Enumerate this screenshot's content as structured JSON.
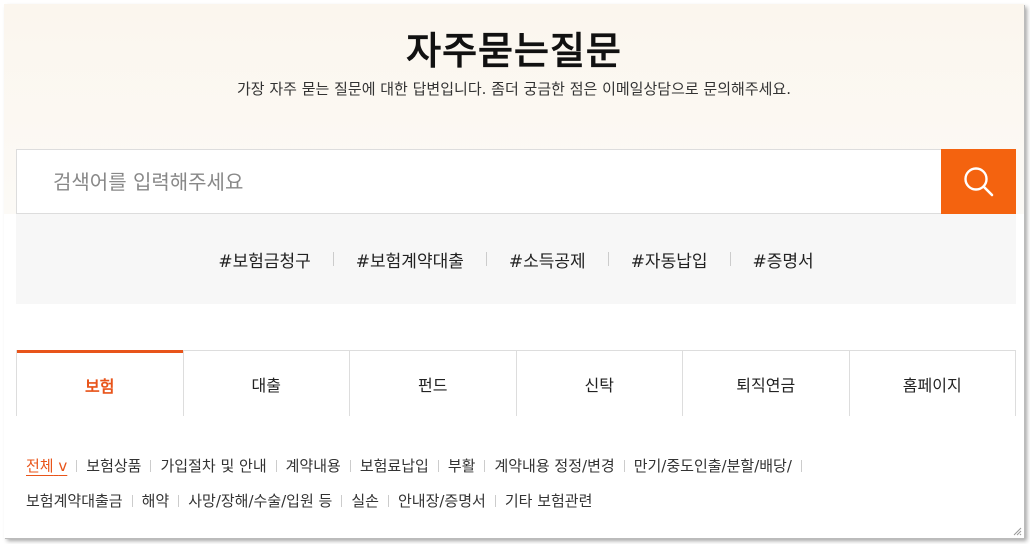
{
  "hero": {
    "title": "자주묻는질문",
    "subtitle": "가장 자주 묻는 질문에 대한 답변입니다. 좀더 궁금한 점은 이메일상담으로 문의해주세요."
  },
  "search": {
    "placeholder": "검색어를 입력해주세요",
    "value": ""
  },
  "hashtags": [
    "#보험금청구",
    "#보험계약대출",
    "#소득공제",
    "#자동납입",
    "#증명서"
  ],
  "tabs": [
    {
      "label": "보험",
      "active": true
    },
    {
      "label": "대출",
      "active": false
    },
    {
      "label": "펀드",
      "active": false
    },
    {
      "label": "신탁",
      "active": false
    },
    {
      "label": "퇴직연금",
      "active": false
    },
    {
      "label": "홈페이지",
      "active": false
    }
  ],
  "categories": {
    "selected": "전체",
    "selected_caret": "v",
    "items": [
      "보험상품",
      "가입절차 및 안내",
      "계약내용",
      "보험료납입",
      "부활",
      "계약내용 정정/변경",
      "만기/중도인출/분할/배당/",
      "보험계약대출금",
      "해약",
      "사망/장해/수술/입원 등",
      "실손",
      "안내장/증명서",
      "기타 보험관련"
    ]
  },
  "colors": {
    "accent": "#f4630f",
    "active_tab": "#e8541a",
    "hero_bg": "#fbf6ee",
    "tag_bg": "#f7f7f7"
  },
  "icons": {
    "search": "search-icon"
  }
}
